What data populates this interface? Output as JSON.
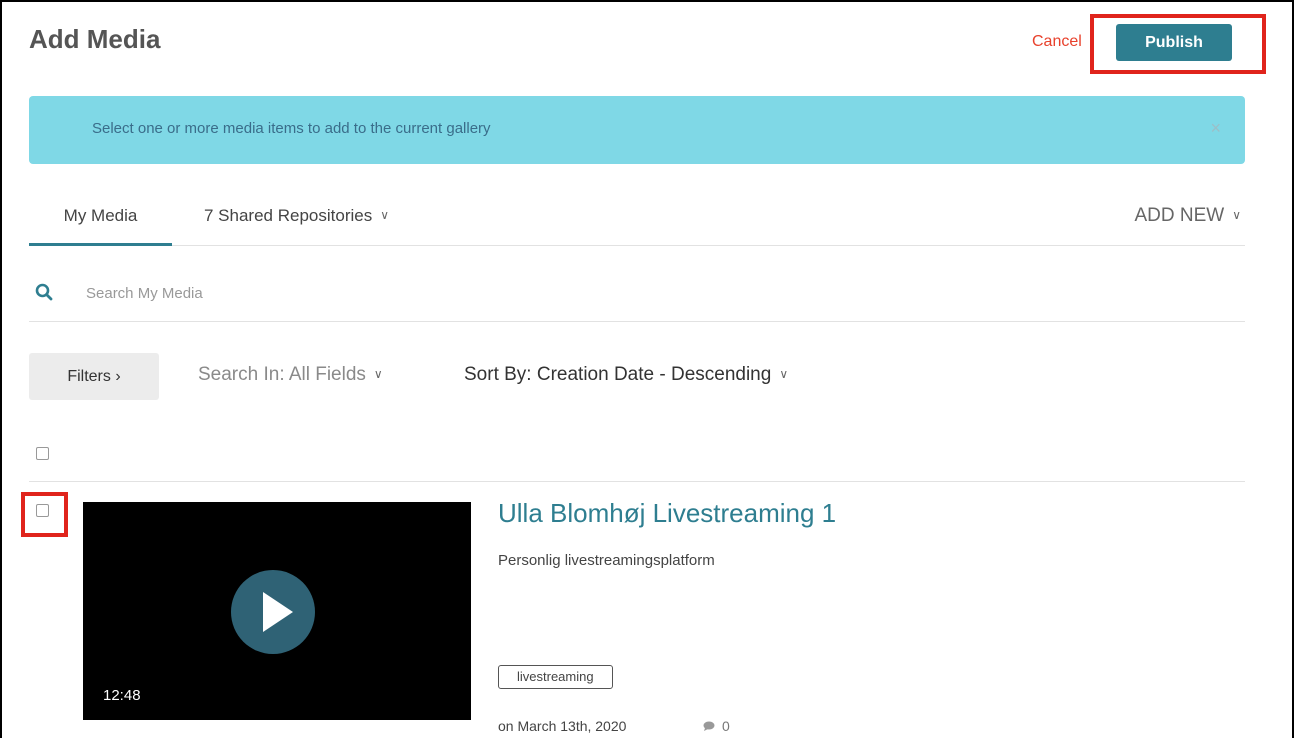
{
  "header": {
    "title": "Add Media",
    "cancel_label": "Cancel",
    "publish_label": "Publish"
  },
  "alert": {
    "message": "Select one or more media items to add to the current gallery",
    "close_glyph": "×"
  },
  "tabs": [
    {
      "label": "My Media",
      "active": true
    },
    {
      "label": "7 Shared Repositories",
      "dropdown": true
    }
  ],
  "add_new_label": "ADD NEW",
  "search": {
    "placeholder": "Search My Media",
    "value": ""
  },
  "toolbar": {
    "filters_label": "Filters",
    "filters_chevron": "›",
    "search_in_label": "Search In: All Fields",
    "sort_by_label": "Sort By: Creation Date - Descending"
  },
  "media_items": [
    {
      "title": "Ulla Blomhøj Livestreaming 1",
      "description": "Personlig livestreamingsplatform",
      "duration": "12:48",
      "tags": [
        "livestreaming"
      ],
      "date": "on March 13th, 2020",
      "comments": "0",
      "checked": false
    }
  ],
  "icons": {
    "search": "search-icon",
    "chevron": "chevron-down-icon",
    "play": "play-icon",
    "comment": "comment-icon",
    "close": "close-icon"
  },
  "colors": {
    "accent": "#2e7e90",
    "cancel": "#e8412c",
    "alert_bg": "#7fd8e6",
    "highlight": "#e0241c"
  }
}
